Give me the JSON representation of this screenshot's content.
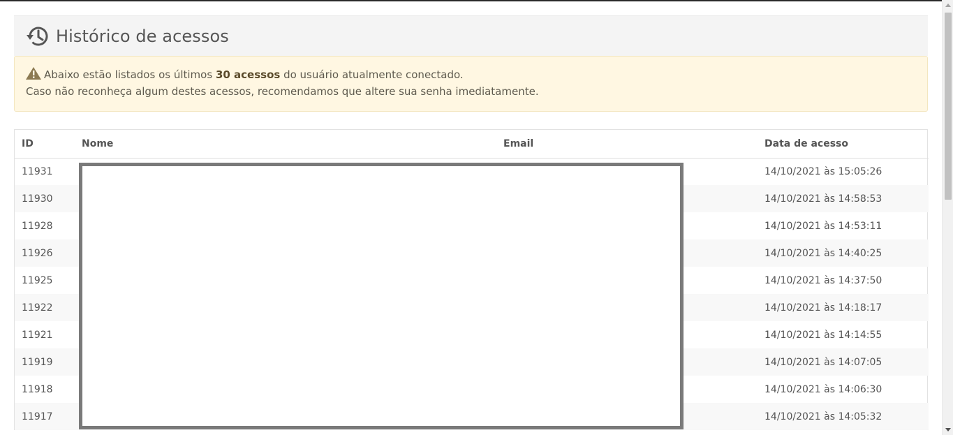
{
  "header": {
    "title": "Histórico de acessos",
    "icon": "history-icon"
  },
  "alert": {
    "icon": "warning-icon",
    "line1_prefix": "Abaixo estão listados os últimos ",
    "line1_bold": "30 acessos",
    "line1_suffix": " do usuário atualmente conectado.",
    "line2": "Caso não reconheça algum destes acessos, recomendamos que altere sua senha imediatamente."
  },
  "table": {
    "columns": [
      "ID",
      "Nome",
      "Email",
      "Data de acesso"
    ],
    "rows": [
      {
        "id": "11931",
        "nome": "",
        "email": "",
        "data": "14/10/2021 às 15:05:26"
      },
      {
        "id": "11930",
        "nome": "",
        "email": "",
        "data": "14/10/2021 às 14:58:53"
      },
      {
        "id": "11928",
        "nome": "",
        "email": "",
        "data": "14/10/2021 às 14:53:11"
      },
      {
        "id": "11926",
        "nome": "",
        "email": "",
        "data": "14/10/2021 às 14:40:25"
      },
      {
        "id": "11925",
        "nome": "",
        "email": "",
        "data": "14/10/2021 às 14:37:50"
      },
      {
        "id": "11922",
        "nome": "",
        "email": "",
        "data": "14/10/2021 às 14:18:17"
      },
      {
        "id": "11921",
        "nome": "",
        "email": "",
        "data": "14/10/2021 às 14:14:55"
      },
      {
        "id": "11919",
        "nome": "",
        "email": "",
        "data": "14/10/2021 às 14:07:05"
      },
      {
        "id": "11918",
        "nome": "",
        "email": "",
        "data": "14/10/2021 às 14:06:30"
      },
      {
        "id": "11917",
        "nome": "",
        "email": "",
        "data": "14/10/2021 às 14:05:32"
      }
    ]
  },
  "colors": {
    "alert_bg": "#fff7e2",
    "header_bg": "#f4f4f4",
    "redaction_border": "#7a7a7a"
  }
}
